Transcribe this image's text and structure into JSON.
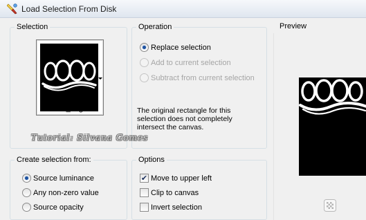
{
  "window": {
    "title": "Load Selection From Disk"
  },
  "selection": {
    "group_title": "Selection",
    "file_name": "curvas_angela"
  },
  "operation": {
    "group_title": "Operation",
    "options": [
      {
        "label": "Replace selection",
        "checked": true,
        "enabled": true
      },
      {
        "label": "Add to current selection",
        "checked": false,
        "enabled": false
      },
      {
        "label": "Subtract from current selection",
        "checked": false,
        "enabled": false
      }
    ],
    "note": "The original rectangle for this selection does not completely intersect the canvas."
  },
  "watermark": "Tutorial: Silvana Gomes",
  "create_from": {
    "group_title": "Create selection from:",
    "options": [
      {
        "label": "Source luminance",
        "checked": true
      },
      {
        "label": "Any non-zero value",
        "checked": false
      },
      {
        "label": "Source opacity",
        "checked": false
      }
    ]
  },
  "options": {
    "group_title": "Options",
    "items": [
      {
        "label": "Move to upper left",
        "checked": true
      },
      {
        "label": "Clip to canvas",
        "checked": false
      },
      {
        "label": "Invert selection",
        "checked": false
      }
    ]
  },
  "preview": {
    "title": "Preview"
  },
  "icons": {
    "app": "app-icon",
    "thumbnail_dropdown": "chevron-down-icon",
    "preview_toggle": "checkerboard-icon"
  },
  "colors": {
    "accent": "#1e52a0",
    "image_background": "#000000",
    "selection_shape": "#ffffff"
  }
}
